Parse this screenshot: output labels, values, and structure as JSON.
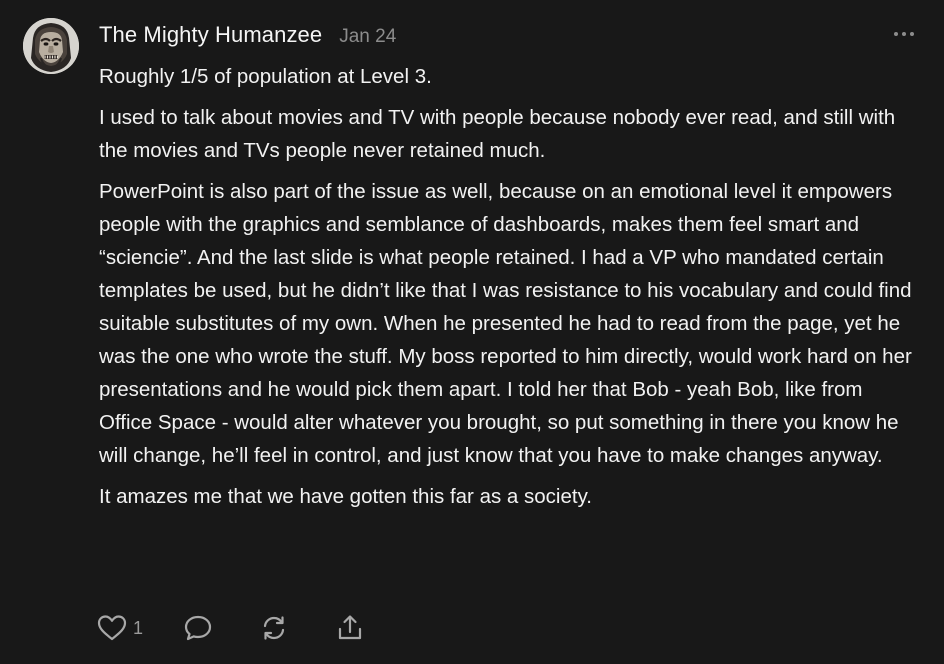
{
  "comment": {
    "author": "The Mighty Humanzee",
    "date": "Jan 24",
    "paragraphs": [
      "Roughly 1/5 of population at Level 3.",
      "I used to talk about movies and TV with people because nobody ever read, and still with the movies and TVs people never retained much.",
      "PowerPoint is also part of the issue as well, because on an emotional level it empowers people with the graphics and semblance of dashboards, makes them feel smart and “sciencie”. And the last slide is what people retained. I had a VP who mandated certain templates be used, but he didn’t like that I was resistance to his vocabulary and could find suitable substitutes of my own. When he presented he had to read from the page, yet he was the one who wrote the stuff. My boss reported to him directly, would work hard on her presentations and he would pick them apart. I told her that Bob - yeah Bob, like from Office Space - would alter whatever you brought, so put something in there you know he will change, he’ll feel in control, and just know that you have to make changes anyway.",
      "It amazes me that we have gotten this far as a society."
    ],
    "like_count": "1"
  },
  "icons": {
    "avatar": "avatar-image",
    "more": "more-options-icon",
    "like": "heart-icon",
    "reply": "comment-bubble-icon",
    "restack": "restack-icon",
    "share": "share-icon"
  },
  "colors": {
    "background": "#181818",
    "text": "#f5f5f5",
    "muted": "#8c8c8c",
    "icon": "#a8a8a8"
  }
}
